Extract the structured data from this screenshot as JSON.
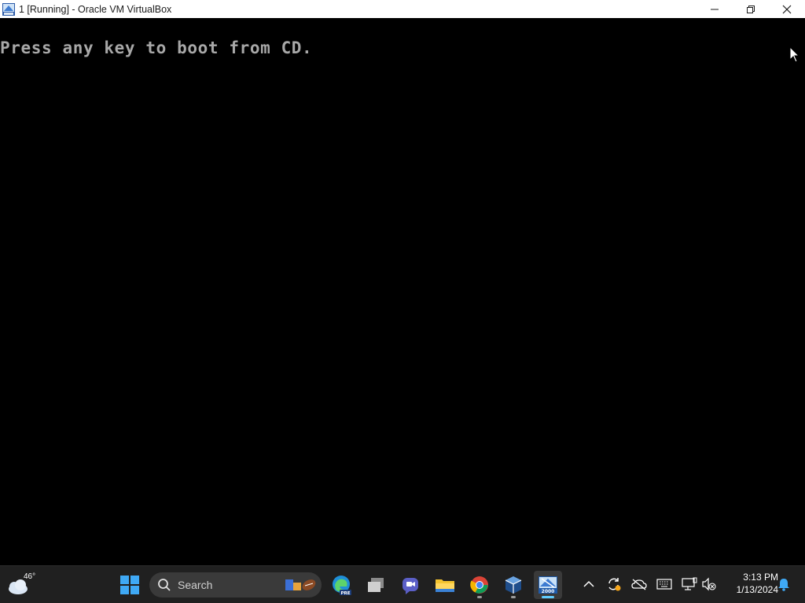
{
  "window": {
    "title": "1 [Running] - Oracle VM VirtualBox",
    "controls": [
      "minimize",
      "restore",
      "close"
    ]
  },
  "vm_screen": {
    "boot_message": "Press any key to boot from CD."
  },
  "taskbar": {
    "weather": {
      "temperature": "46°",
      "icon": "cloud-night-icon"
    },
    "start_icon": "windows-logo-icon",
    "search": {
      "placeholder": "Search"
    },
    "apps": [
      {
        "name": "search-highlights",
        "icon": "football-highlights-icon"
      },
      {
        "name": "edge-preview",
        "icon": "edge-beta-icon",
        "badge": "PRE"
      },
      {
        "name": "task-view",
        "icon": "task-view-icon"
      },
      {
        "name": "teams-chat",
        "icon": "teams-icon"
      },
      {
        "name": "file-explorer",
        "icon": "folder-icon"
      },
      {
        "name": "chrome",
        "icon": "chrome-icon"
      },
      {
        "name": "virtualbox",
        "icon": "virtualbox-icon"
      },
      {
        "name": "windows-2000-vm",
        "icon": "windows-2000-icon",
        "badge": "2000"
      }
    ],
    "tray": [
      "chevron-up-icon",
      "sync-icon",
      "onedrive-icon",
      "keyboard-icon",
      "network-icon",
      "volume-muted-icon"
    ],
    "clock": {
      "time": "3:13 PM",
      "date": "1/13/2024"
    },
    "notification_icon": "bell-icon"
  },
  "colors": {
    "accent": "#60cdff",
    "taskbar": "#202020",
    "boot_text": "#a8a8a8"
  }
}
